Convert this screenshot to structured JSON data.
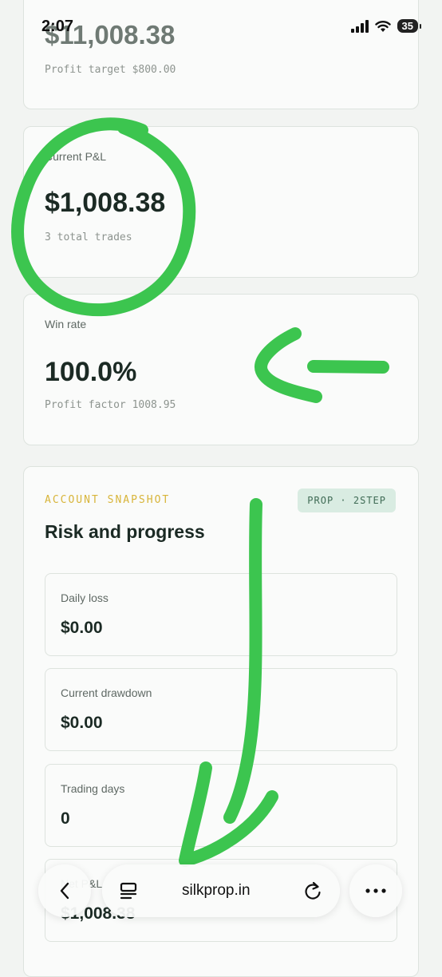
{
  "status_bar": {
    "time": "2:07",
    "battery": "35"
  },
  "top_card": {
    "value": "$11,008.38",
    "subtext": "Profit target $800.00"
  },
  "pnl_card": {
    "label": "Current P&L",
    "value": "$1,008.38",
    "subtext": "3 total trades"
  },
  "winrate_card": {
    "label": "Win rate",
    "value": "100.0%",
    "subtext": "Profit factor 1008.95"
  },
  "snapshot": {
    "eyebrow": "ACCOUNT SNAPSHOT",
    "badge": "PROP · 2STEP",
    "title": "Risk and progress",
    "metrics": [
      {
        "label": "Daily loss",
        "value": "$0.00"
      },
      {
        "label": "Current drawdown",
        "value": "$0.00"
      },
      {
        "label": "Trading days",
        "value": "0"
      },
      {
        "label": "Net P&L",
        "value": "$1,008.38"
      }
    ]
  },
  "browser": {
    "url": "silkprop.in"
  },
  "annotation_color": "#3cc54f"
}
